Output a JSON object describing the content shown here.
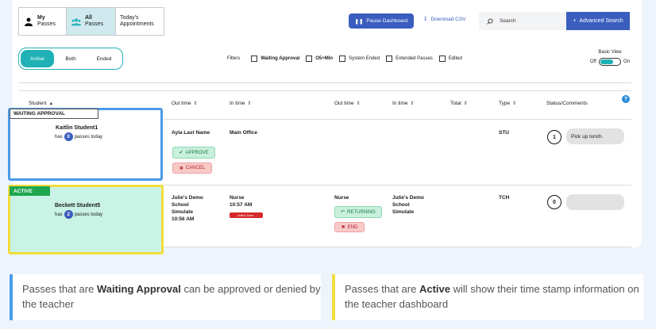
{
  "view_tabs": {
    "my": {
      "line1": "My",
      "line2": "Passes"
    },
    "all": {
      "line1": "All",
      "line2": "Passes"
    },
    "today": {
      "line1": "Today's",
      "line2": "Appointments"
    }
  },
  "toolbar": {
    "pause_label": "Pause Dashboard",
    "csv_label": "Download CSV",
    "search_placeholder": "Search",
    "advanced_label": "Advanced Search"
  },
  "status_tabs": [
    "Active",
    "Both",
    "Ended"
  ],
  "filters": {
    "label": "Filters",
    "items": [
      "Waiting Approval",
      "O5+Min",
      "System Ended",
      "Extended Passes",
      "Edited"
    ]
  },
  "basic_view": {
    "label": "Basic View",
    "off": "Off",
    "on": "On"
  },
  "columns": [
    "Student",
    "Out time",
    "In time",
    "Out time",
    "In time",
    "Total",
    "Type",
    "Status/Comments"
  ],
  "rows": [
    {
      "state_label": "WAITING APPROVAL",
      "student": "Kaitlin Student1",
      "has": "has",
      "pass_count": "0",
      "passes_today": "passes today",
      "out_from": "Ayla Last Name",
      "in_to": "Main Office",
      "approve_label": "APPROVE",
      "cancel_label": "CANCEL",
      "type": "STU",
      "comment_count": "1",
      "comment": "Pick up lunch."
    },
    {
      "state_label": "ACTIVE",
      "student": "Beckett Student5",
      "has": "has",
      "pass_count": "2",
      "passes_today": "passes today",
      "out_from_l1": "Julie's Demo",
      "out_from_l2": "School",
      "out_from_l3": "Simulate",
      "out_time": "10:56 AM",
      "in_to": "Nurse",
      "in_time": "10:57 AM",
      "in_tag": "Julie's Dem..",
      "out2_place": "Nurse",
      "in2_l1": "Julie's Demo",
      "in2_l2": "School",
      "in2_l3": "Simulate",
      "returning_label": "RETURNING",
      "end_label": "END",
      "type": "TCH",
      "comment_count": "0",
      "comment": ""
    }
  ],
  "callouts": {
    "left": {
      "pre": "Passes that are ",
      "bold": "Waiting Approval",
      "post": " can be approved or denied by the teacher"
    },
    "right": {
      "pre": "Passes that are ",
      "bold": "Active",
      "post": " will show their time stamp information on the teacher dashboard"
    }
  },
  "colors": {
    "accent": "#3a5dbf",
    "teal": "#1fb1b6",
    "waiting": "#4a9be8",
    "active": "#f2dc3c"
  }
}
